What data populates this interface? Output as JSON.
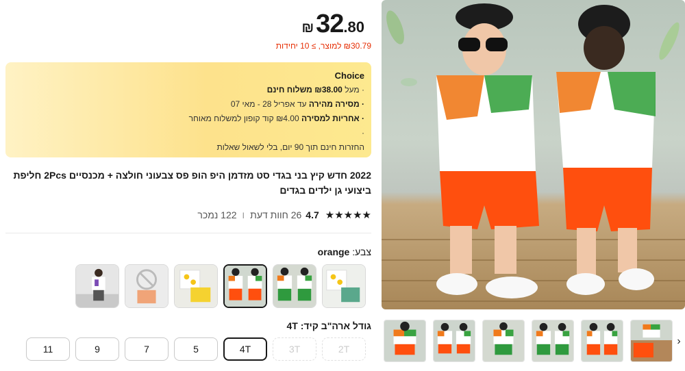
{
  "price": {
    "currency": "₪",
    "integer": "32",
    "fraction": ".80"
  },
  "unit_price": "₪30.79 למוצר, ≥ 10 יחידות",
  "choice": {
    "title": "Choice",
    "line1_pre": "· מעל ",
    "line1_bold": "₪38.00 משלוח חינם",
    "line2_bold": "· מסירה מהירה",
    "line2_rest": " עד אפריל 28 - מאי 07",
    "line3_bold": "· אחריות למסירה",
    "line3_rest": " ₪4.00 קוד קופון למשלוח מאוחר",
    "line4": "·",
    "line5": "החזרות חינם תוך 90 יום, בלי לשאול שאלות"
  },
  "title": "2022 חדש קיץ בני בגדי סט מזדמן היפ הופ פס צבעוני חולצה + מכנסיים 2Pcs חליפת ביצועי גן ילדים בגדים",
  "rating": {
    "stars": "★★★★★",
    "value": "4.7",
    "reviews": "26 חוות דעת",
    "separator": "ו",
    "sold": "122 נמכר"
  },
  "color": {
    "label": "צבע:",
    "selected": "orange"
  },
  "size": {
    "label": "גודל ארה\"ב קיד:",
    "selected": "4T",
    "options": [
      "2T",
      "3T",
      "4T",
      "5",
      "7",
      "9",
      "11"
    ]
  },
  "gallery": {
    "next_arrow": "›"
  },
  "colors": {
    "accent_red": "#e62e04",
    "choice_bg": "#fde98f",
    "selected_border": "#191919"
  }
}
